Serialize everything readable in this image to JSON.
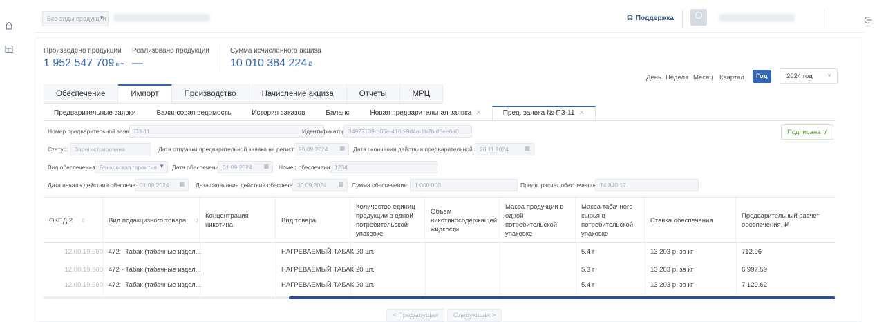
{
  "nav": {
    "home_icon": "home-icon",
    "table_icon": "table-icon",
    "exit_icon": "logout-icon"
  },
  "topbar": {
    "product_select_value": "Все виды продукции",
    "support_label": "Поддержка"
  },
  "stats": {
    "produced_label": "Произведено продукции",
    "produced_value": "1 952 547 709",
    "produced_unit": "шт.",
    "sold_label": "Реализовано продукции",
    "sold_value": "—",
    "excise_label": "Сумма исчисленного акциза",
    "excise_value": "10 010 384 224",
    "excise_unit": "₽"
  },
  "period": {
    "options": [
      "День",
      "Неделя",
      "Месяц",
      "Квартал",
      "Год"
    ],
    "active": "Год",
    "year": "2024 год"
  },
  "main_tabs": [
    "Обеспечение",
    "Импорт",
    "Производство",
    "Начисление акциза",
    "Отчеты",
    "МРЦ"
  ],
  "main_tab_active": "Импорт",
  "sub_tabs": [
    "Предварительные заявки",
    "Балансовая ведомость",
    "История заказов",
    "Баланс",
    "Новая предварительная заявка",
    "Пред. заявка № ПЗ-11"
  ],
  "form": {
    "request_number_label": "Номер предварительной заявки:",
    "request_number_value": "ПЗ-11",
    "identifier_label": "Идентификатор:",
    "identifier_value": "34927139-b05e-416c-9d4a-1b7baf6ee6a0",
    "status_label": "Статус:",
    "status_value": "Зарегистрирована",
    "sent_date_label": "Дата отправки предварительной заявки на регистрацию:",
    "sent_date_value": "26.09.2024",
    "expiry_date_label": "Дата окончания действия предварительной заявки:",
    "expiry_date_value": "26.11.2024",
    "guarantee_type_label": "Вид обеспечения:",
    "guarantee_type_value": "Банковская гарантия",
    "guarantee_date_label": "Дата обеспечения:",
    "guarantee_date_value": "01.09.2024",
    "guarantee_number_label": "Номер обеспечения:",
    "guarantee_number_value": "1234",
    "guarantee_start_label": "Дата начала действия обеспечения:",
    "guarantee_start_value": "01.09.2024",
    "guarantee_end_label": "Дата окончания действия обеспечения:",
    "guarantee_end_value": "30.09.2024",
    "guarantee_sum_label": "Сумма обеспечения, ₽:",
    "guarantee_sum_value": "1 000 000",
    "prelim_calc_label": "Предв. расчет обеспечения, ₽:",
    "prelim_calc_value": "14 840.17",
    "status_badge": "Подписана"
  },
  "table": {
    "columns": [
      "ОКПД 2",
      "Вид подакцизного товара",
      "Концентрация никотина",
      "Вид товара",
      "Количество единиц продукции в одной потребительской упаковке",
      "Объем никотиносодержащей жидкости",
      "Масса продукции в одной потребительской упаковке",
      "Масса табачного сырья в потребительской упаковке",
      "Ставка обеспечения",
      "Предварительный расчет обеспечения, ₽"
    ],
    "rows": [
      [
        "12.00.19.600",
        "472 - Табак (табачные издел...",
        "",
        "НАГРЕВАЕМЫЙ ТАБАК",
        "20 шт.",
        "",
        "",
        "5.4 г",
        "13 203 р. за кг",
        "712.96"
      ],
      [
        "12.00.19.600",
        "472 - Табак (табачные издел...",
        "",
        "НАГРЕВАЕМЫЙ ТАБАК",
        "20 шт.",
        "",
        "",
        "5.3 г",
        "13 203 р. за кг",
        "6 997.59"
      ],
      [
        "12.00.19.600",
        "472 - Табак (табачные издел...",
        "",
        "НАГРЕВАЕМЫЙ ТАБАК",
        "20 шт.",
        "",
        "",
        "5.4 г",
        "13 203 р. за кг",
        "7 129.62"
      ]
    ]
  },
  "pager": {
    "prev_label": "< Предыдущая",
    "next_label": "Следующая >"
  }
}
